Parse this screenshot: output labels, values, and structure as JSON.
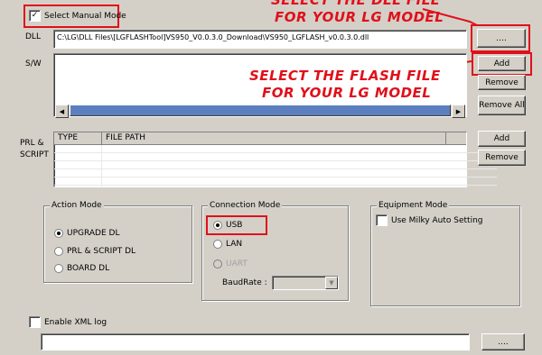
{
  "manual_mode": {
    "label": "Select Manual Mode",
    "checked": true
  },
  "dll": {
    "label": "DLL",
    "path": "C:\\LG\\DLL Files\\[LGFLASHTool]VS950_V0.0.3.0_Download\\VS950_LGFLASH_v0.0.3.0.dll",
    "browse_label": "...."
  },
  "sw": {
    "label": "S/W",
    "add_label": "Add",
    "remove_label": "Remove",
    "remove_all_label": "Remove All"
  },
  "prl": {
    "label_line1": "PRL  &",
    "label_line2": "SCRIPT",
    "columns": [
      "TYPE",
      "FILE PATH"
    ],
    "add_label": "Add",
    "remove_label": "Remove"
  },
  "action_mode": {
    "title": "Action Mode",
    "options": [
      "UPGRADE DL",
      "PRL & SCRIPT DL",
      "BOARD DL"
    ],
    "selected": "UPGRADE DL"
  },
  "connection_mode": {
    "title": "Connection Mode",
    "options": [
      "USB",
      "LAN",
      "UART"
    ],
    "selected": "USB",
    "baudrate_label": "BaudRate :",
    "baudrate_value": ""
  },
  "equipment_mode": {
    "title": "Equipment Mode",
    "milky_label": "Use Milky Auto Setting",
    "milky_checked": false
  },
  "xml_log": {
    "label": "Enable XML log",
    "checked": false,
    "path": "",
    "browse_label": "...."
  },
  "annotations": {
    "dll_line1": "SELECT THE DLL FILE",
    "dll_line2": "FOR YOUR LG MODEL",
    "flash_line1": "SELECT THE FLASH FILE",
    "flash_line2": "FOR YOUR LG MODEL"
  },
  "colors": {
    "annotation": "#e0101a",
    "window_bg": "#d4d0c8"
  }
}
